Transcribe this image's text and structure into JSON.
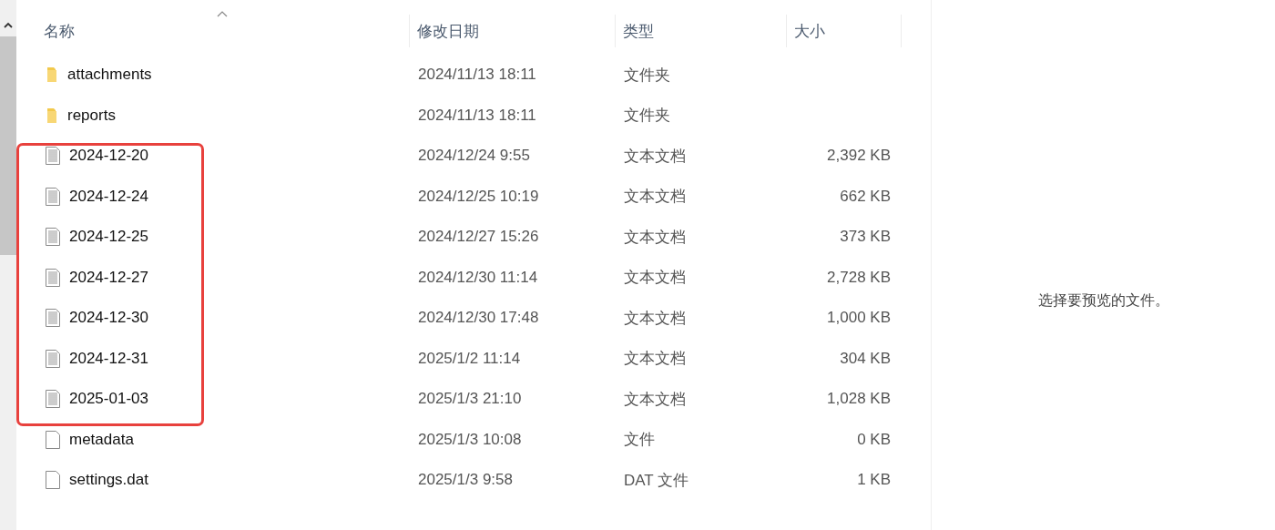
{
  "columns": [
    {
      "label": "名称",
      "sorted": true
    },
    {
      "label": "修改日期",
      "sorted": false
    },
    {
      "label": "类型",
      "sorted": false
    },
    {
      "label": "大小",
      "sorted": false
    }
  ],
  "rows": [
    {
      "kind": "folder",
      "name": "attachments",
      "modified": "2024/11/13 18:11",
      "type": "文件夹",
      "highlighted": false
    },
    {
      "kind": "folder",
      "name": "reports",
      "modified": "2024/11/13 18:11",
      "type": "文件夹",
      "highlighted": false
    },
    {
      "kind": "text",
      "name": "2024-12-20",
      "modified": "2024/12/24 9:55",
      "type": "文本文档",
      "size": "2,392 KB",
      "highlighted": true
    },
    {
      "kind": "text",
      "name": "2024-12-24",
      "modified": "2024/12/25 10:19",
      "type": "文本文档",
      "size": "662 KB",
      "highlighted": true
    },
    {
      "kind": "text",
      "name": "2024-12-25",
      "modified": "2024/12/27 15:26",
      "type": "文本文档",
      "size": "373 KB",
      "highlighted": true
    },
    {
      "kind": "text",
      "name": "2024-12-27",
      "modified": "2024/12/30 11:14",
      "type": "文本文档",
      "size": "2,728 KB",
      "highlighted": true
    },
    {
      "kind": "text",
      "name": "2024-12-30",
      "modified": "2024/12/30 17:48",
      "type": "文本文档",
      "size": "1,000 KB",
      "highlighted": true
    },
    {
      "kind": "text",
      "name": "2024-12-31",
      "modified": "2025/1/2 11:14",
      "type": "文本文档",
      "size": "304 KB",
      "highlighted": true
    },
    {
      "kind": "text",
      "name": "2025-01-03",
      "modified": "2025/1/3 21:10",
      "type": "文本文档",
      "size": "1,028 KB",
      "highlighted": true
    },
    {
      "kind": "file",
      "name": "metadata",
      "modified": "2025/1/3 10:08",
      "type": "文件",
      "size": "0 KB",
      "highlighted": false
    },
    {
      "kind": "file",
      "name": "settings.dat",
      "modified": "2025/1/3 9:58",
      "type": "DAT 文件",
      "size": "1 KB",
      "highlighted": false
    }
  ],
  "preview": {
    "message": "选择要预览的文件。"
  }
}
